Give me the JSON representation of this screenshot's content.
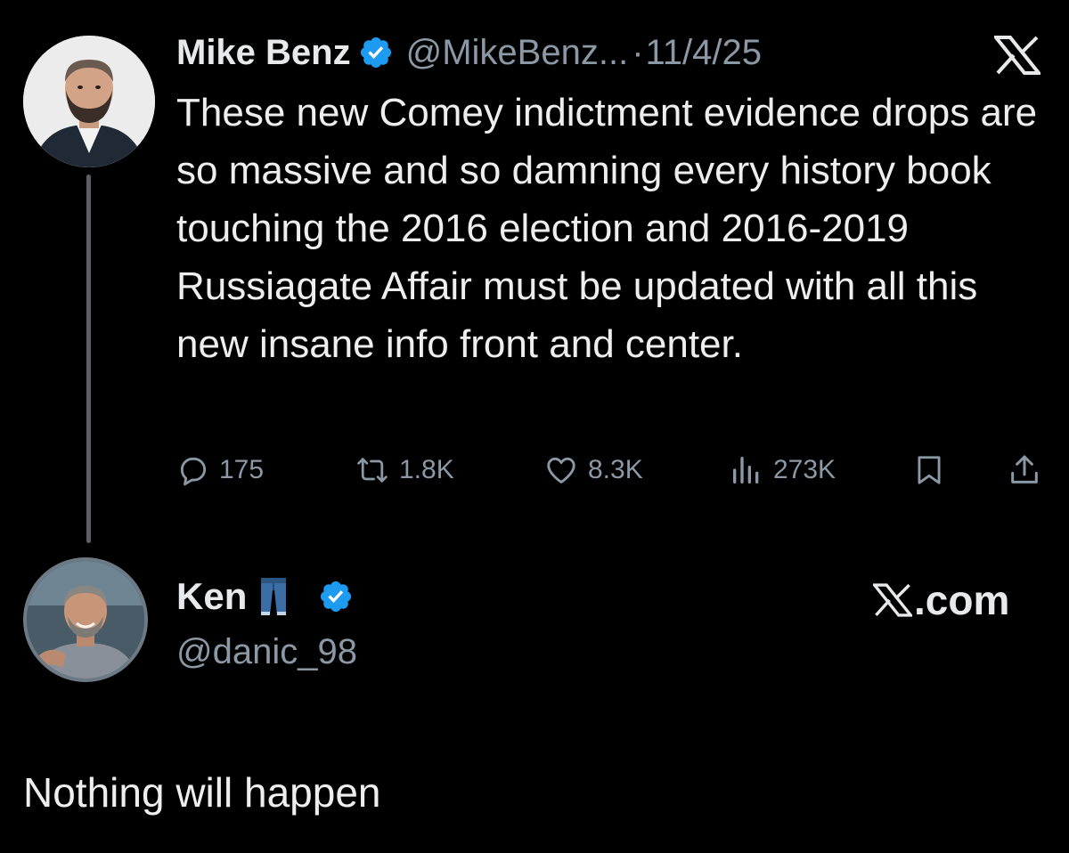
{
  "tweet": {
    "author_name": "Mike Benz",
    "author_handle": "@MikeBenz...",
    "separator": "·",
    "date": "11/4/25",
    "text": "These new Comey indictment evidence drops are so massive and so damning every history book touching the 2016 election and 2016-2019 Russiagate Affair must be updated with all this new insane info front and center.",
    "actions": {
      "replies": "175",
      "reposts": "1.8K",
      "likes": "8.3K",
      "views": "273K"
    },
    "icons": [
      "reply-icon",
      "repost-icon",
      "like-icon",
      "views-icon",
      "bookmark-icon",
      "share-icon",
      "x-logo-icon",
      "verified-badge-icon"
    ]
  },
  "reply": {
    "author_name": "Ken",
    "author_handle": "@danic_98",
    "emoji": "jeans-emoji",
    "site_label": ".com",
    "text": "Nothing will happen"
  },
  "colors": {
    "background": "#000000",
    "text": "#e7e9ea",
    "muted": "#8b98a5",
    "verified": "#1d9bf0",
    "thread_line": "#5a5f63"
  }
}
